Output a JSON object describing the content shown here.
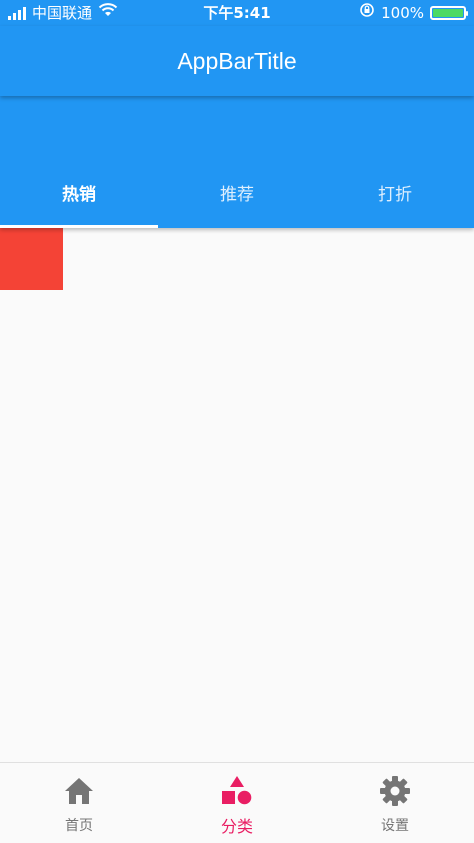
{
  "status_bar": {
    "carrier": "中国联通",
    "time": "下午5:41",
    "battery_percent": "100%",
    "battery_level": 1.0,
    "icons": [
      "signal-icon",
      "wifi-icon",
      "rotation-lock-icon",
      "battery-icon"
    ]
  },
  "app_bar": {
    "title": "AppBarTitle",
    "color": "#2196f3"
  },
  "tabs": {
    "items": [
      {
        "label": "热销",
        "selected": true
      },
      {
        "label": "推荐",
        "selected": false
      },
      {
        "label": "打折",
        "selected": false
      }
    ]
  },
  "content": {
    "box_color": "#f44336"
  },
  "bottom_nav": {
    "items": [
      {
        "label": "首页",
        "icon": "home-icon",
        "active": false
      },
      {
        "label": "分类",
        "icon": "category-icon",
        "active": true
      },
      {
        "label": "设置",
        "icon": "settings-icon",
        "active": false
      }
    ],
    "active_color": "#e91e63",
    "inactive_color": "#757575"
  }
}
